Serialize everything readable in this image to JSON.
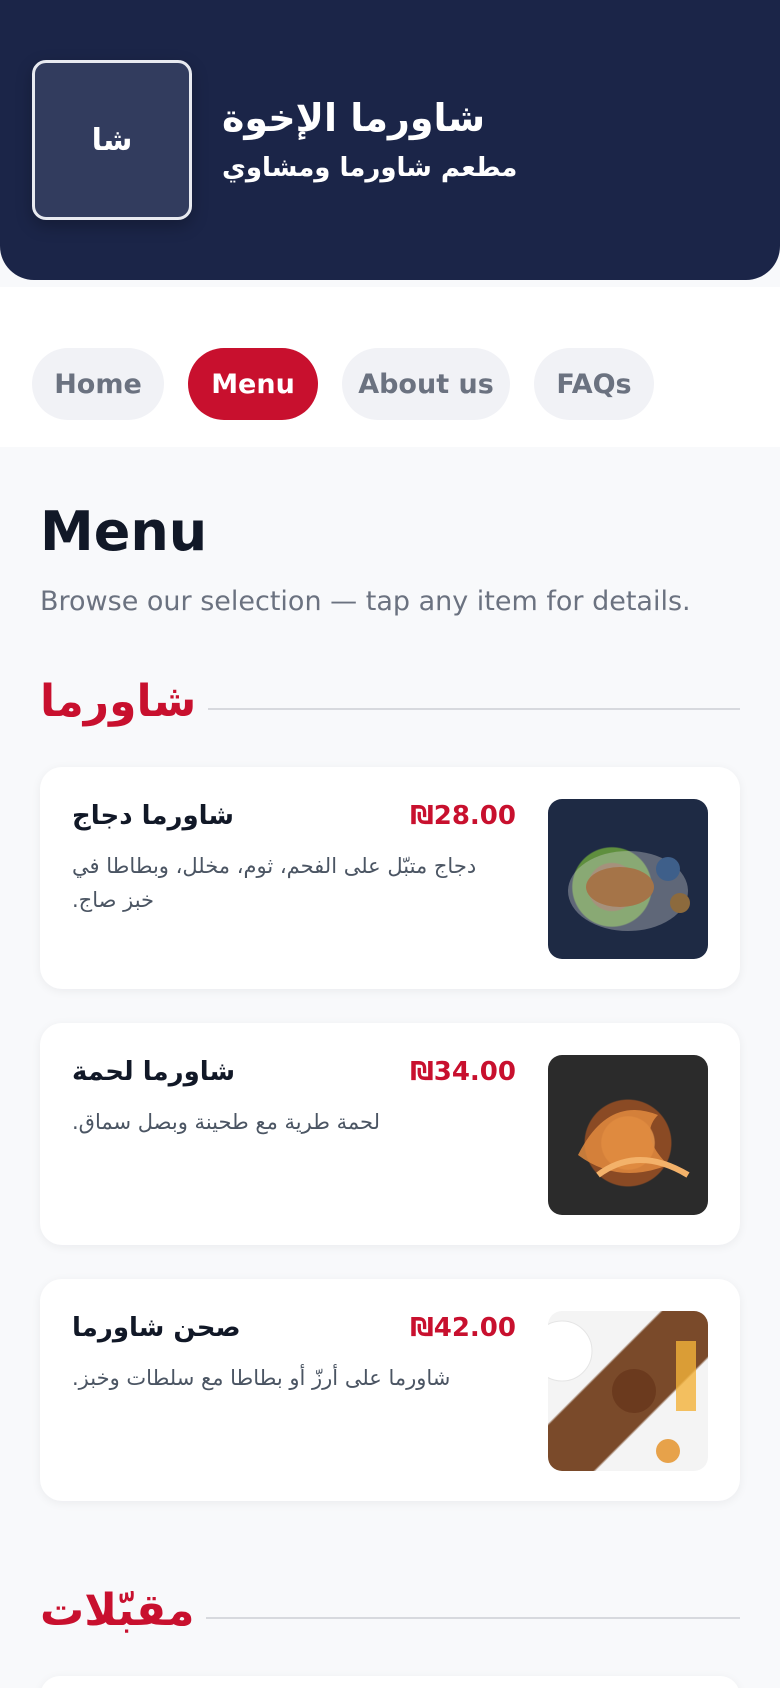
{
  "header": {
    "logo_text": "شا",
    "name": "شاورما الإخوة",
    "subtitle": "مطعم شاورما ومشاوي"
  },
  "nav": {
    "items": [
      {
        "label": "Home",
        "active": false
      },
      {
        "label": "Menu",
        "active": true
      },
      {
        "label": "About us",
        "active": false
      },
      {
        "label": "FAQs",
        "active": false
      }
    ]
  },
  "page": {
    "title": "Menu",
    "subtitle": "Browse our selection — tap any item for details."
  },
  "sections": [
    {
      "title": "شاورما",
      "items": [
        {
          "name": "شاورما دجاج",
          "price": "₪28.00",
          "description": "دجاج متبّل على الفحم، ثوم، مخلل، وبطاطا في خبز صاج."
        },
        {
          "name": "شاورما لحمة",
          "price": "₪34.00",
          "description": "لحمة طرية مع طحينة وبصل سماق."
        },
        {
          "name": "صحن شاورما",
          "price": "₪42.00",
          "description": "شاورما على أرزّ أو بطاطا مع سلطات وخبز."
        }
      ]
    },
    {
      "title": "مقبّلات",
      "items": []
    }
  ],
  "colors": {
    "header_bg": "#1b2548",
    "accent": "#c8102e",
    "page_bg": "#f8f9fb"
  }
}
